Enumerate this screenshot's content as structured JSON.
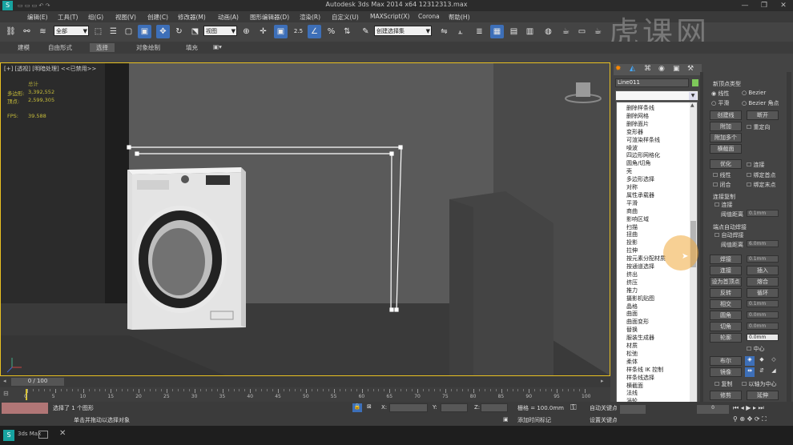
{
  "window": {
    "title": "Autodesk 3ds Max  2014 x64     12312313.max",
    "min": "—",
    "max": "❐",
    "close": "✕"
  },
  "menu": [
    "编辑(E)",
    "工具(T)",
    "组(G)",
    "视图(V)",
    "创建(C)",
    "修改器(M)",
    "动画(A)",
    "图形编辑器(D)",
    "渲染(R)",
    "自定义(U)",
    "MAXScript(X)",
    "Corona",
    "帮助(H)"
  ],
  "toolbar": {
    "selection_filter": "全部",
    "ref_coord": "视图",
    "named_sel": "创建选择集",
    "snap": "2.5",
    "pct": "%"
  },
  "ribbon": {
    "tabs": [
      "建模",
      "自由形式",
      "选择",
      "对象绘制",
      "填充"
    ]
  },
  "viewport": {
    "label": "[+] [透视] [明暗处理]  <<已禁用>>",
    "stats": {
      "head": "总计",
      "poly_label": "多边形:",
      "poly": "3,392,552",
      "vert_label": "顶点:",
      "vert": "2,599,305",
      "fps_label": "FPS:",
      "fps": "39.588"
    }
  },
  "panel": {
    "object_name": "Line011",
    "new_vertex_type": {
      "title": "新顶点类型",
      "linear": "线性",
      "bezier": "Bezier",
      "smooth": "平滑",
      "bezier_corner": "Bezier 角点"
    },
    "buttons": {
      "create_line": "创建线",
      "break": "断开",
      "attach": "附加",
      "reorient": "重定向",
      "attach_mult": "附加多个",
      "cross_section": "横截面",
      "optimize": "优化",
      "connect": "连接",
      "linear": "线性",
      "bind_first": "绑定首点",
      "closed": "闭合",
      "bind_last": "绑定末点"
    },
    "connect_copy": {
      "title": "连接复制",
      "connect": "连接",
      "threshold": "阈值距离",
      "value": "0.1mm"
    },
    "auto_weld": {
      "title": "端点自动焊接",
      "auto": "自动焊接",
      "threshold": "阈值距离",
      "value": "6.0mm"
    },
    "ops": [
      {
        "l": "焊接",
        "v": "0.1mm"
      },
      {
        "l": "连接",
        "r": "插入"
      },
      {
        "l": "设为首顶点",
        "r": "熔合"
      },
      {
        "l": "反转",
        "r": "循环"
      },
      {
        "l": "相交",
        "v": "0.1mm"
      },
      {
        "l": "圆角",
        "v": "0.0mm"
      },
      {
        "l": "切角",
        "v": "0.0mm"
      },
      {
        "l": "轮廓",
        "v": "0.0mm"
      }
    ],
    "center": "中心",
    "boolean": "布尔",
    "mirror": "镜像",
    "copy": "复制",
    "about_pivot": "以轴为中心",
    "trim": "修剪",
    "extend": "延伸"
  },
  "modifier_list": [
    "删除样条线",
    "删除网格",
    "删除面片",
    "变形器",
    "可渲染样条线",
    "噪波",
    "四边形网格化",
    "圆角/切角",
    "壳",
    "多边形选择",
    "对称",
    "属性承载器",
    "平滑",
    "商曲",
    "影响区域",
    "扫描",
    "扭曲",
    "投影",
    "拉伸",
    "按元素分配材质",
    "按通道选择",
    "挤出",
    "挤压",
    "推力",
    "摄影机贴图",
    "晶格",
    "曲面",
    "曲面变形",
    "替换",
    "服装生成器",
    "材质",
    "松弛",
    "柔体",
    "样条线 IK 控制",
    "样条线选择",
    "横截面",
    "法线",
    "涡轮",
    "波浪",
    "涡轮平滑"
  ],
  "timeline": {
    "frame": "0 / 100",
    "ticks": [
      "0",
      "5",
      "10",
      "15",
      "20",
      "25",
      "30",
      "35",
      "40",
      "45",
      "50",
      "55",
      "60",
      "65",
      "70",
      "75",
      "80",
      "85",
      "90",
      "95",
      "100"
    ]
  },
  "status": {
    "selected": "选择了 1 个图形",
    "hint": "单击并拖动以选择对象",
    "x_label": "X:",
    "y_label": "Y:",
    "z_label": "Z:",
    "grid": "栅格 = 100.0mm",
    "auto_key": "自动关键点",
    "set_key": "设置关键点",
    "add_time_tag": "添加时间标记",
    "key_filter": "关键点过滤器"
  },
  "taskbar": {
    "app": "3ds Max"
  },
  "watermark": "虎课网"
}
